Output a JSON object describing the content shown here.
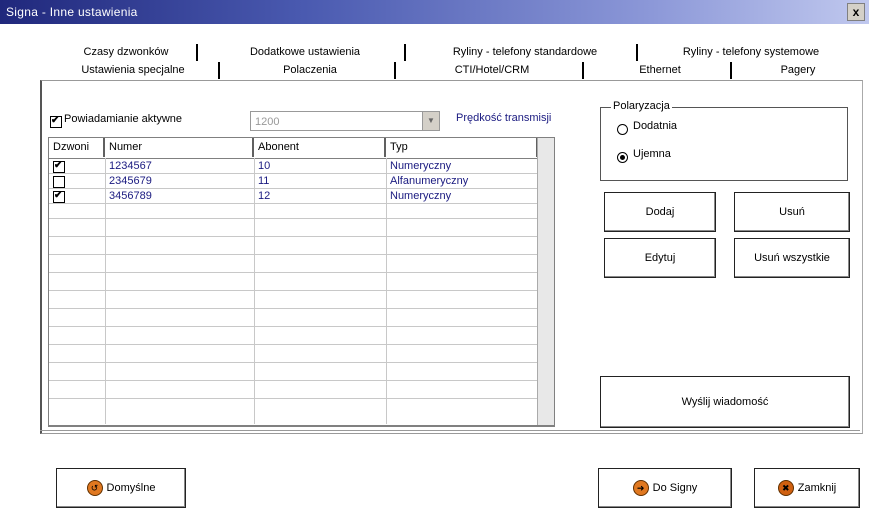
{
  "window": {
    "title": "Signa - Inne ustawienia",
    "close_label": "x"
  },
  "tabs": {
    "row1": [
      {
        "label": "Czasy dzwonków"
      },
      {
        "label": "Dodatkowe ustawienia"
      },
      {
        "label": "Ryliny - telefony standardowe"
      },
      {
        "label": "Ryliny - telefony systemowe"
      }
    ],
    "row2": [
      {
        "label": "Ustawienia specjalne"
      },
      {
        "label": "Polaczenia"
      },
      {
        "label": "CTI/Hotel/CRM"
      },
      {
        "label": "Ethernet"
      },
      {
        "label": "Pagery"
      }
    ],
    "active": "Pagery"
  },
  "notification": {
    "label": "Powiadamianie aktywne",
    "checked": true
  },
  "speed": {
    "value": "1200",
    "label": "Prędkość transmisji"
  },
  "table": {
    "columns": [
      "Dzwoni",
      "Numer",
      "Abonent",
      "Typ"
    ],
    "rows": [
      {
        "ring": true,
        "number": "1234567",
        "subscriber": "10",
        "type": "Numeryczny"
      },
      {
        "ring": false,
        "number": "2345679",
        "subscriber": "11",
        "type": "Alfanumeryczny"
      },
      {
        "ring": true,
        "number": "3456789",
        "subscriber": "12",
        "type": "Numeryczny"
      }
    ]
  },
  "polarization": {
    "legend": "Polaryzacja",
    "options": [
      {
        "label": "Dodatnia",
        "selected": false
      },
      {
        "label": "Ujemna",
        "selected": true
      }
    ]
  },
  "buttons": {
    "add": "Dodaj",
    "delete": "Usuń",
    "edit": "Edytuj",
    "delete_all": "Usuń wszystkie",
    "send_message": "Wyślij wiadomość",
    "default": "Domyślne",
    "to_signa": "Do Signy",
    "close": "Zamknij"
  }
}
